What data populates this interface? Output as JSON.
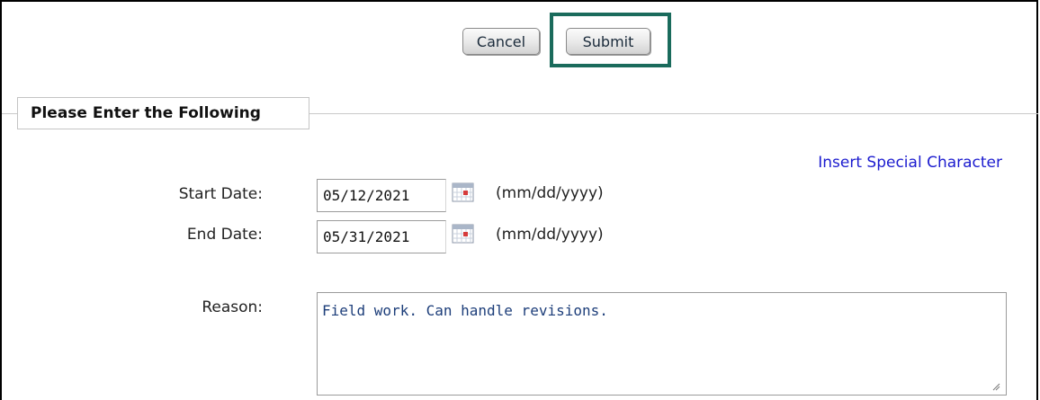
{
  "toolbar": {
    "cancel_label": "Cancel",
    "submit_label": "Submit",
    "highlight_color": "#1a6b5c"
  },
  "section": {
    "title": "Please Enter the Following"
  },
  "insert_special_character": "Insert Special Character",
  "form": {
    "start_date": {
      "label": "Start Date:",
      "value": "05/12/2021",
      "format_hint": "(mm/dd/yyyy)",
      "icon": "calendar-icon"
    },
    "end_date": {
      "label": "End Date:",
      "value": "05/31/2021",
      "format_hint": "(mm/dd/yyyy)",
      "icon": "calendar-icon"
    },
    "reason": {
      "label": "Reason:",
      "value": "Field work. Can handle revisions."
    }
  },
  "colors": {
    "link": "#1c1ccf",
    "textarea_text": "#1d3e7a"
  }
}
